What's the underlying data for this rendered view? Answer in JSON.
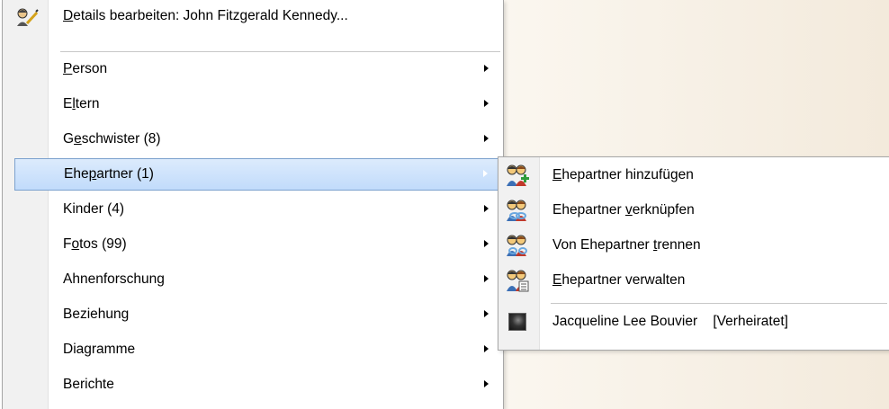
{
  "main_menu": {
    "header": {
      "label_pre": "",
      "label_ul": "D",
      "label_post": "etails bearbeiten: John Fitzgerald Kennedy...",
      "icon": "edit-person-icon"
    },
    "items": [
      {
        "pre": "",
        "ul": "P",
        "post": "erson",
        "submenu": true
      },
      {
        "pre": "E",
        "ul": "l",
        "post": "tern",
        "submenu": true
      },
      {
        "pre": "G",
        "ul": "e",
        "post": "schwister (8)",
        "submenu": true
      },
      {
        "pre": "Ehe",
        "ul": "p",
        "post": "artner (1)",
        "submenu": true,
        "highlighted": true
      },
      {
        "pre": "Kinder (4)",
        "ul": "",
        "post": "",
        "submenu": true
      },
      {
        "pre": "F",
        "ul": "o",
        "post": "tos (99)",
        "submenu": true
      },
      {
        "pre": "Ahnenforschung",
        "ul": "",
        "post": "",
        "submenu": true
      },
      {
        "pre": "Beziehung",
        "ul": "",
        "post": "",
        "submenu": true
      },
      {
        "pre": "Diagramme",
        "ul": "",
        "post": "",
        "submenu": true
      },
      {
        "pre": "Berichte",
        "ul": "",
        "post": "",
        "submenu": true
      }
    ]
  },
  "sub_menu": {
    "items": [
      {
        "pre": "",
        "ul": "E",
        "post": "hepartner hinzufügen",
        "icon": "add-spouse-icon"
      },
      {
        "pre": "Ehepartner ",
        "ul": "v",
        "post": "erknüpfen",
        "icon": "link-spouse-icon"
      },
      {
        "pre": "Von Ehepartner ",
        "ul": "t",
        "post": "rennen",
        "icon": "unlink-spouse-icon"
      },
      {
        "pre": "",
        "ul": "E",
        "post": "hepartner verwalten",
        "icon": "manage-spouses-icon"
      }
    ],
    "spouse": {
      "name": "Jacqueline Lee Bouvier",
      "status": "[Verheiratet]",
      "icon": "person-photo-icon"
    }
  },
  "colors": {
    "highlight": "#c9e0fc",
    "highlight_border": "#7da2ce",
    "gutter": "#f1f1f1",
    "icon_face": "#f3c97a",
    "icon_accent": "#2e9b3a"
  }
}
